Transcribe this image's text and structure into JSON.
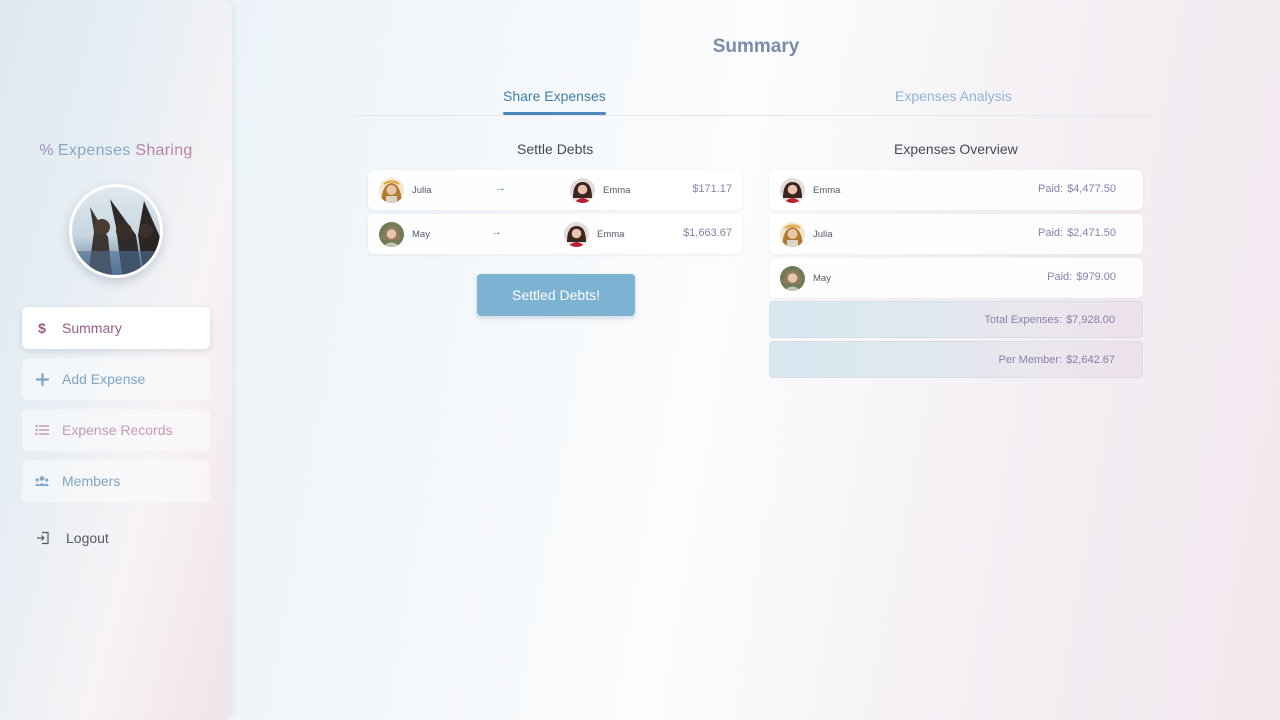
{
  "sidebar": {
    "brand": {
      "symbol": "%",
      "word1": "Expenses",
      "word2": "Sharing"
    },
    "nav": [
      {
        "label": "Summary",
        "icon": "dollar-icon"
      },
      {
        "label": "Add Expense",
        "icon": "plus-icon"
      },
      {
        "label": "Expense Records",
        "icon": "list-icon"
      },
      {
        "label": "Members",
        "icon": "members-icon"
      }
    ],
    "logout": "Logout"
  },
  "main": {
    "title": "Summary",
    "tabs": [
      {
        "label": "Share Expenses",
        "active": true
      },
      {
        "label": "Expenses Analysis",
        "active": false
      }
    ],
    "settle": {
      "title": "Settle Debts",
      "arrow": "→",
      "debts": [
        {
          "from": "Julia",
          "to": "Emma",
          "amount": "$171.17"
        },
        {
          "from": "May",
          "to": "Emma",
          "amount": "$1,663.67"
        }
      ],
      "button": "Settled Debts!"
    },
    "overview": {
      "title": "Expenses Overview",
      "paid_label": "Paid:",
      "members": [
        {
          "name": "Emma",
          "paid": "$4,477.50"
        },
        {
          "name": "Julia",
          "paid": "$2,471.50"
        },
        {
          "name": "May",
          "paid": "$979.00"
        }
      ],
      "total_label": "Total Expenses:",
      "total_value": "$7,928.00",
      "per_member_label": "Per Member:",
      "per_member_value": "$2,642.67"
    }
  },
  "colors": {
    "accent": "#4d89b8",
    "button": "#7cb3d2",
    "amount": "#8a7fa8"
  }
}
